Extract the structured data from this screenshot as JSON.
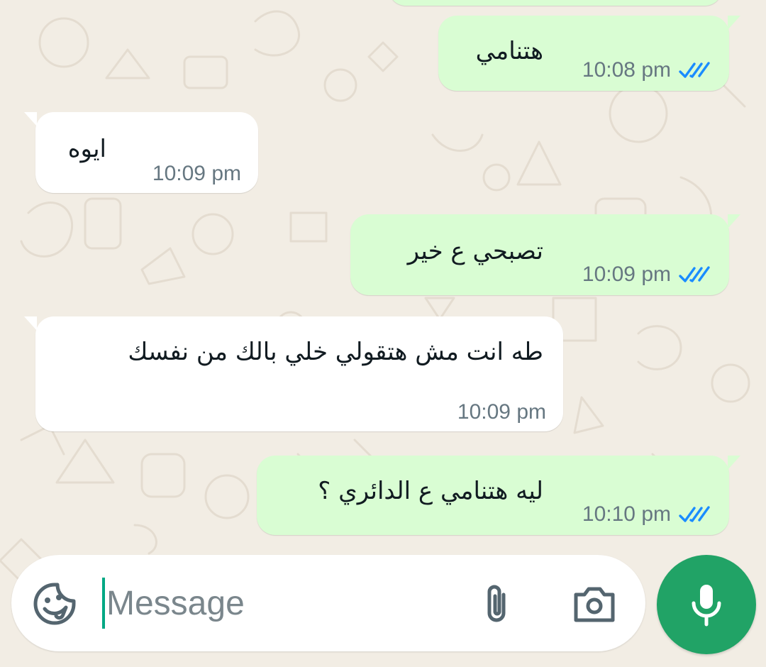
{
  "messages": [
    {
      "text": "هتنامي",
      "time": "10:08 pm",
      "direction": "outgoing",
      "status": "read"
    },
    {
      "text": "ايوه",
      "time": "10:09 pm",
      "direction": "incoming"
    },
    {
      "text": "تصبحي ع خير",
      "time": "10:09 pm",
      "direction": "outgoing",
      "status": "read"
    },
    {
      "text": "طه انت مش هتقولي خلي بالك من نفسك",
      "time": "10:09 pm",
      "direction": "incoming"
    },
    {
      "text": "ليه هتنامي ع الدائري ؟",
      "time": "10:10 pm",
      "direction": "outgoing",
      "status": "read"
    }
  ],
  "composer": {
    "placeholder": "Message",
    "value": "",
    "icons": {
      "emoji": "sticker-emoji-icon",
      "attach": "paperclip-icon",
      "camera": "camera-icon",
      "mic": "microphone-icon"
    }
  },
  "colors": {
    "wallpaper": "#f2ede4",
    "outgoing_bubble": "#d9fdd3",
    "incoming_bubble": "#ffffff",
    "read_ticks": "#1a8cff",
    "accent": "#21a366",
    "timestamp": "#667781"
  }
}
